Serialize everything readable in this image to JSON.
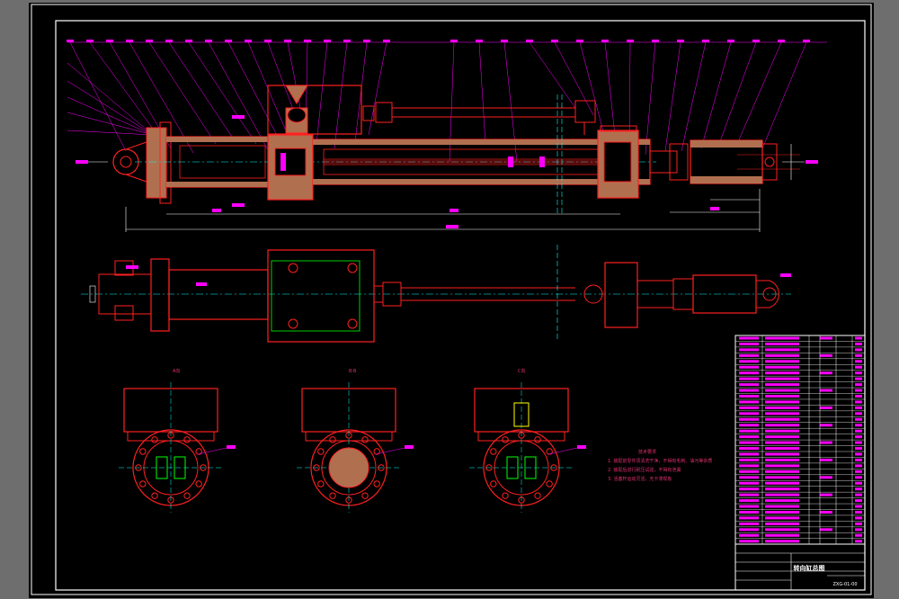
{
  "drawing": {
    "background_color": "#000000",
    "frame_color": "#ffffff",
    "part_color": "#ff2020",
    "leader_color": "#ff00ff",
    "centerline_color": "#00ffff",
    "hidden_color": "#00ff00",
    "hatch_color": "#d08060",
    "bolt_color": "#ffff00"
  },
  "title_block": {
    "title": "转向缸总图",
    "drawing_no": "ZXG-01-00"
  },
  "technical_requirements": {
    "heading": "技术要求",
    "items": [
      "1. 装配前零件须清洗干净，不得有毛刺、油污等杂质",
      "2. 装配后进行耐压试验，不得有泄漏",
      "3. 活塞杆运动灵活，无卡滞现象"
    ]
  },
  "view_labels": [
    "A向",
    "B-B",
    "C向"
  ]
}
